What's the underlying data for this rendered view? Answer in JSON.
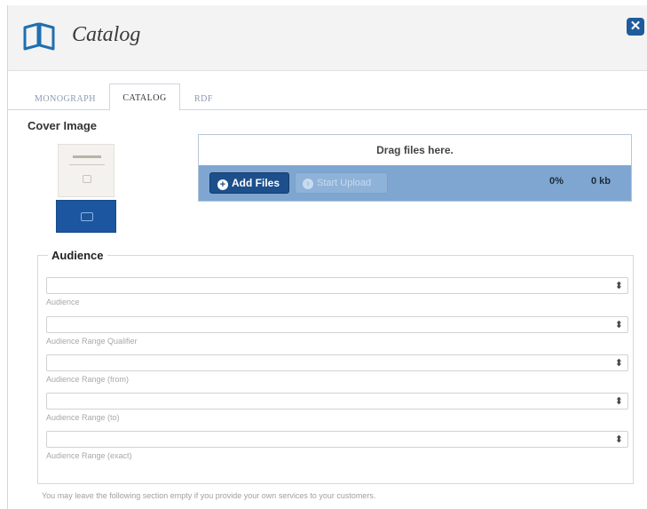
{
  "header": {
    "title": "Catalog",
    "close_symbol": "✕"
  },
  "tabs": [
    {
      "label": "MONOGRAPH",
      "active": false
    },
    {
      "label": "CATALOG",
      "active": true
    },
    {
      "label": "RDF",
      "active": false
    }
  ],
  "cover": {
    "label": "Cover Image"
  },
  "uploader": {
    "drop_text": "Drag files here.",
    "add_files_label": "Add Files",
    "start_upload_label": "Start Upload",
    "progress_percent": "0%",
    "total_size": "0 kb",
    "accent_color": "#7ea6d1"
  },
  "audience": {
    "legend": "Audience",
    "fields": [
      {
        "label": "Audience",
        "value": ""
      },
      {
        "label": "Audience Range Qualifier",
        "value": ""
      },
      {
        "label": "Audience Range (from)",
        "value": ""
      },
      {
        "label": "Audience Range (to)",
        "value": ""
      },
      {
        "label": "Audience Range (exact)",
        "value": ""
      }
    ]
  },
  "footnote": "You may leave the following section empty if you provide your own services to your customers."
}
